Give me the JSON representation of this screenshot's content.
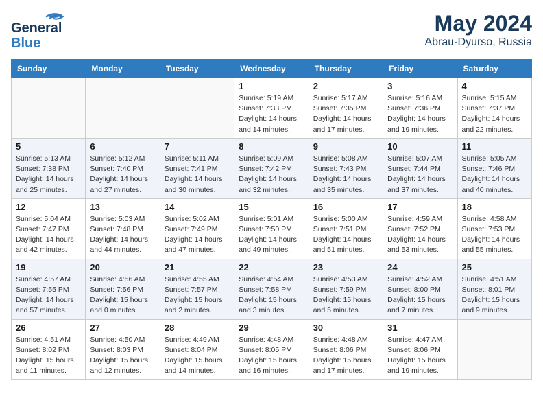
{
  "header": {
    "logo_general": "General",
    "logo_blue": "Blue",
    "month_title": "May 2024",
    "location": "Abrau-Dyurso, Russia"
  },
  "weekdays": [
    "Sunday",
    "Monday",
    "Tuesday",
    "Wednesday",
    "Thursday",
    "Friday",
    "Saturday"
  ],
  "weeks": [
    [
      {
        "day": "",
        "info": ""
      },
      {
        "day": "",
        "info": ""
      },
      {
        "day": "",
        "info": ""
      },
      {
        "day": "1",
        "info": "Sunrise: 5:19 AM\nSunset: 7:33 PM\nDaylight: 14 hours\nand 14 minutes."
      },
      {
        "day": "2",
        "info": "Sunrise: 5:17 AM\nSunset: 7:35 PM\nDaylight: 14 hours\nand 17 minutes."
      },
      {
        "day": "3",
        "info": "Sunrise: 5:16 AM\nSunset: 7:36 PM\nDaylight: 14 hours\nand 19 minutes."
      },
      {
        "day": "4",
        "info": "Sunrise: 5:15 AM\nSunset: 7:37 PM\nDaylight: 14 hours\nand 22 minutes."
      }
    ],
    [
      {
        "day": "5",
        "info": "Sunrise: 5:13 AM\nSunset: 7:38 PM\nDaylight: 14 hours\nand 25 minutes."
      },
      {
        "day": "6",
        "info": "Sunrise: 5:12 AM\nSunset: 7:40 PM\nDaylight: 14 hours\nand 27 minutes."
      },
      {
        "day": "7",
        "info": "Sunrise: 5:11 AM\nSunset: 7:41 PM\nDaylight: 14 hours\nand 30 minutes."
      },
      {
        "day": "8",
        "info": "Sunrise: 5:09 AM\nSunset: 7:42 PM\nDaylight: 14 hours\nand 32 minutes."
      },
      {
        "day": "9",
        "info": "Sunrise: 5:08 AM\nSunset: 7:43 PM\nDaylight: 14 hours\nand 35 minutes."
      },
      {
        "day": "10",
        "info": "Sunrise: 5:07 AM\nSunset: 7:44 PM\nDaylight: 14 hours\nand 37 minutes."
      },
      {
        "day": "11",
        "info": "Sunrise: 5:05 AM\nSunset: 7:46 PM\nDaylight: 14 hours\nand 40 minutes."
      }
    ],
    [
      {
        "day": "12",
        "info": "Sunrise: 5:04 AM\nSunset: 7:47 PM\nDaylight: 14 hours\nand 42 minutes."
      },
      {
        "day": "13",
        "info": "Sunrise: 5:03 AM\nSunset: 7:48 PM\nDaylight: 14 hours\nand 44 minutes."
      },
      {
        "day": "14",
        "info": "Sunrise: 5:02 AM\nSunset: 7:49 PM\nDaylight: 14 hours\nand 47 minutes."
      },
      {
        "day": "15",
        "info": "Sunrise: 5:01 AM\nSunset: 7:50 PM\nDaylight: 14 hours\nand 49 minutes."
      },
      {
        "day": "16",
        "info": "Sunrise: 5:00 AM\nSunset: 7:51 PM\nDaylight: 14 hours\nand 51 minutes."
      },
      {
        "day": "17",
        "info": "Sunrise: 4:59 AM\nSunset: 7:52 PM\nDaylight: 14 hours\nand 53 minutes."
      },
      {
        "day": "18",
        "info": "Sunrise: 4:58 AM\nSunset: 7:53 PM\nDaylight: 14 hours\nand 55 minutes."
      }
    ],
    [
      {
        "day": "19",
        "info": "Sunrise: 4:57 AM\nSunset: 7:55 PM\nDaylight: 14 hours\nand 57 minutes."
      },
      {
        "day": "20",
        "info": "Sunrise: 4:56 AM\nSunset: 7:56 PM\nDaylight: 15 hours\nand 0 minutes."
      },
      {
        "day": "21",
        "info": "Sunrise: 4:55 AM\nSunset: 7:57 PM\nDaylight: 15 hours\nand 2 minutes."
      },
      {
        "day": "22",
        "info": "Sunrise: 4:54 AM\nSunset: 7:58 PM\nDaylight: 15 hours\nand 3 minutes."
      },
      {
        "day": "23",
        "info": "Sunrise: 4:53 AM\nSunset: 7:59 PM\nDaylight: 15 hours\nand 5 minutes."
      },
      {
        "day": "24",
        "info": "Sunrise: 4:52 AM\nSunset: 8:00 PM\nDaylight: 15 hours\nand 7 minutes."
      },
      {
        "day": "25",
        "info": "Sunrise: 4:51 AM\nSunset: 8:01 PM\nDaylight: 15 hours\nand 9 minutes."
      }
    ],
    [
      {
        "day": "26",
        "info": "Sunrise: 4:51 AM\nSunset: 8:02 PM\nDaylight: 15 hours\nand 11 minutes."
      },
      {
        "day": "27",
        "info": "Sunrise: 4:50 AM\nSunset: 8:03 PM\nDaylight: 15 hours\nand 12 minutes."
      },
      {
        "day": "28",
        "info": "Sunrise: 4:49 AM\nSunset: 8:04 PM\nDaylight: 15 hours\nand 14 minutes."
      },
      {
        "day": "29",
        "info": "Sunrise: 4:48 AM\nSunset: 8:05 PM\nDaylight: 15 hours\nand 16 minutes."
      },
      {
        "day": "30",
        "info": "Sunrise: 4:48 AM\nSunset: 8:06 PM\nDaylight: 15 hours\nand 17 minutes."
      },
      {
        "day": "31",
        "info": "Sunrise: 4:47 AM\nSunset: 8:06 PM\nDaylight: 15 hours\nand 19 minutes."
      },
      {
        "day": "",
        "info": ""
      }
    ]
  ]
}
